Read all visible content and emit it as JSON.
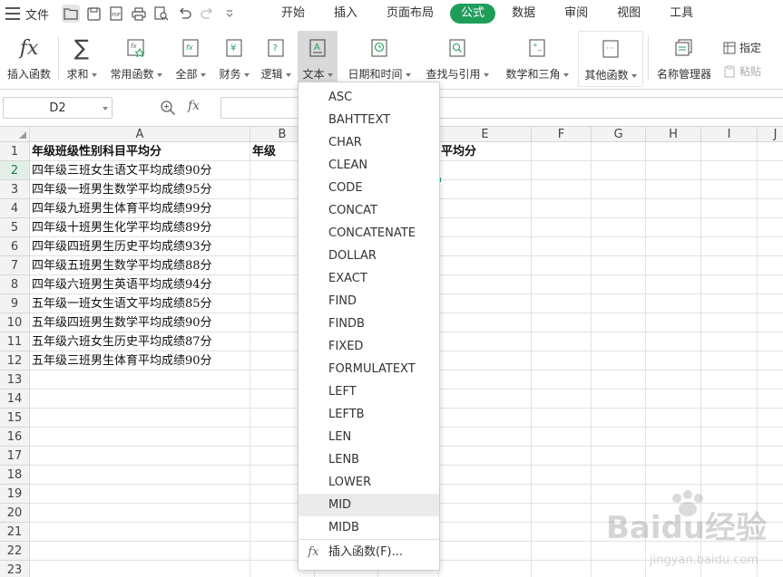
{
  "menubar": {
    "file_label": "文件",
    "tabs": [
      {
        "label": "开始",
        "active": false
      },
      {
        "label": "插入",
        "active": false
      },
      {
        "label": "页面布局",
        "active": false
      },
      {
        "label": "公式",
        "active": true
      },
      {
        "label": "数据",
        "active": false
      },
      {
        "label": "审阅",
        "active": false
      },
      {
        "label": "视图",
        "active": false
      },
      {
        "label": "工具",
        "active": false
      }
    ]
  },
  "ribbon": {
    "insert_function": "插入函数",
    "sum": "求和",
    "common_functions": "常用函数",
    "all": "全部",
    "finance": "财务",
    "logic": "逻辑",
    "text": "文本",
    "datetime": "日期和时间",
    "lookup": "查找与引用",
    "math": "数学和三角",
    "other": "其他函数",
    "name_manager": "名称管理器",
    "specify": "指定",
    "paste": "粘贴"
  },
  "formula_bar": {
    "name_box": "D2",
    "fx_label": "fx",
    "value": ""
  },
  "grid": {
    "columns": [
      "A",
      "B",
      "C",
      "D",
      "E",
      "F",
      "G",
      "H",
      "I",
      "J"
    ],
    "rows": [
      "1",
      "2",
      "3",
      "4",
      "5",
      "6",
      "7",
      "8",
      "9",
      "10",
      "11",
      "12",
      "13",
      "14",
      "15",
      "16",
      "17",
      "18",
      "19",
      "20",
      "21",
      "22",
      "23"
    ],
    "cells": {
      "A1": "年级班级性别科目平均分",
      "B1": "年级",
      "E1": "平均分",
      "A2": "四年级三班女生语文平均成绩90分",
      "A3": "四年级一班男生数学平均成绩95分",
      "A4": "四年级九班男生体育平均成绩99分",
      "A5": "四年级十班男生化学平均成绩89分",
      "A6": "四年级四班男生历史平均成绩93分",
      "A7": "四年级五班男生数学平均成绩88分",
      "A8": "四年级六班男生英语平均成绩94分",
      "A9": "五年级一班女生语文平均成绩85分",
      "A10": "五年级四班男生数学平均成绩90分",
      "A11": "五年级六班女生历史平均成绩87分",
      "A12": "五年级三班男生体育平均成绩90分"
    }
  },
  "dropdown": {
    "items": [
      "ASC",
      "BAHTTEXT",
      "CHAR",
      "CLEAN",
      "CODE",
      "CONCAT",
      "CONCATENATE",
      "DOLLAR",
      "EXACT",
      "FIND",
      "FINDB",
      "FIXED",
      "FORMULATEXT",
      "LEFT",
      "LEFTB",
      "LEN",
      "LENB",
      "LOWER",
      "MID",
      "MIDB"
    ],
    "hovered": "MID",
    "footer": "插入函数(F)..."
  },
  "watermark": {
    "text": "Baidu经验",
    "sub": "jingyan.baidu.com"
  },
  "colors": {
    "accent": "#1f9e5a"
  }
}
